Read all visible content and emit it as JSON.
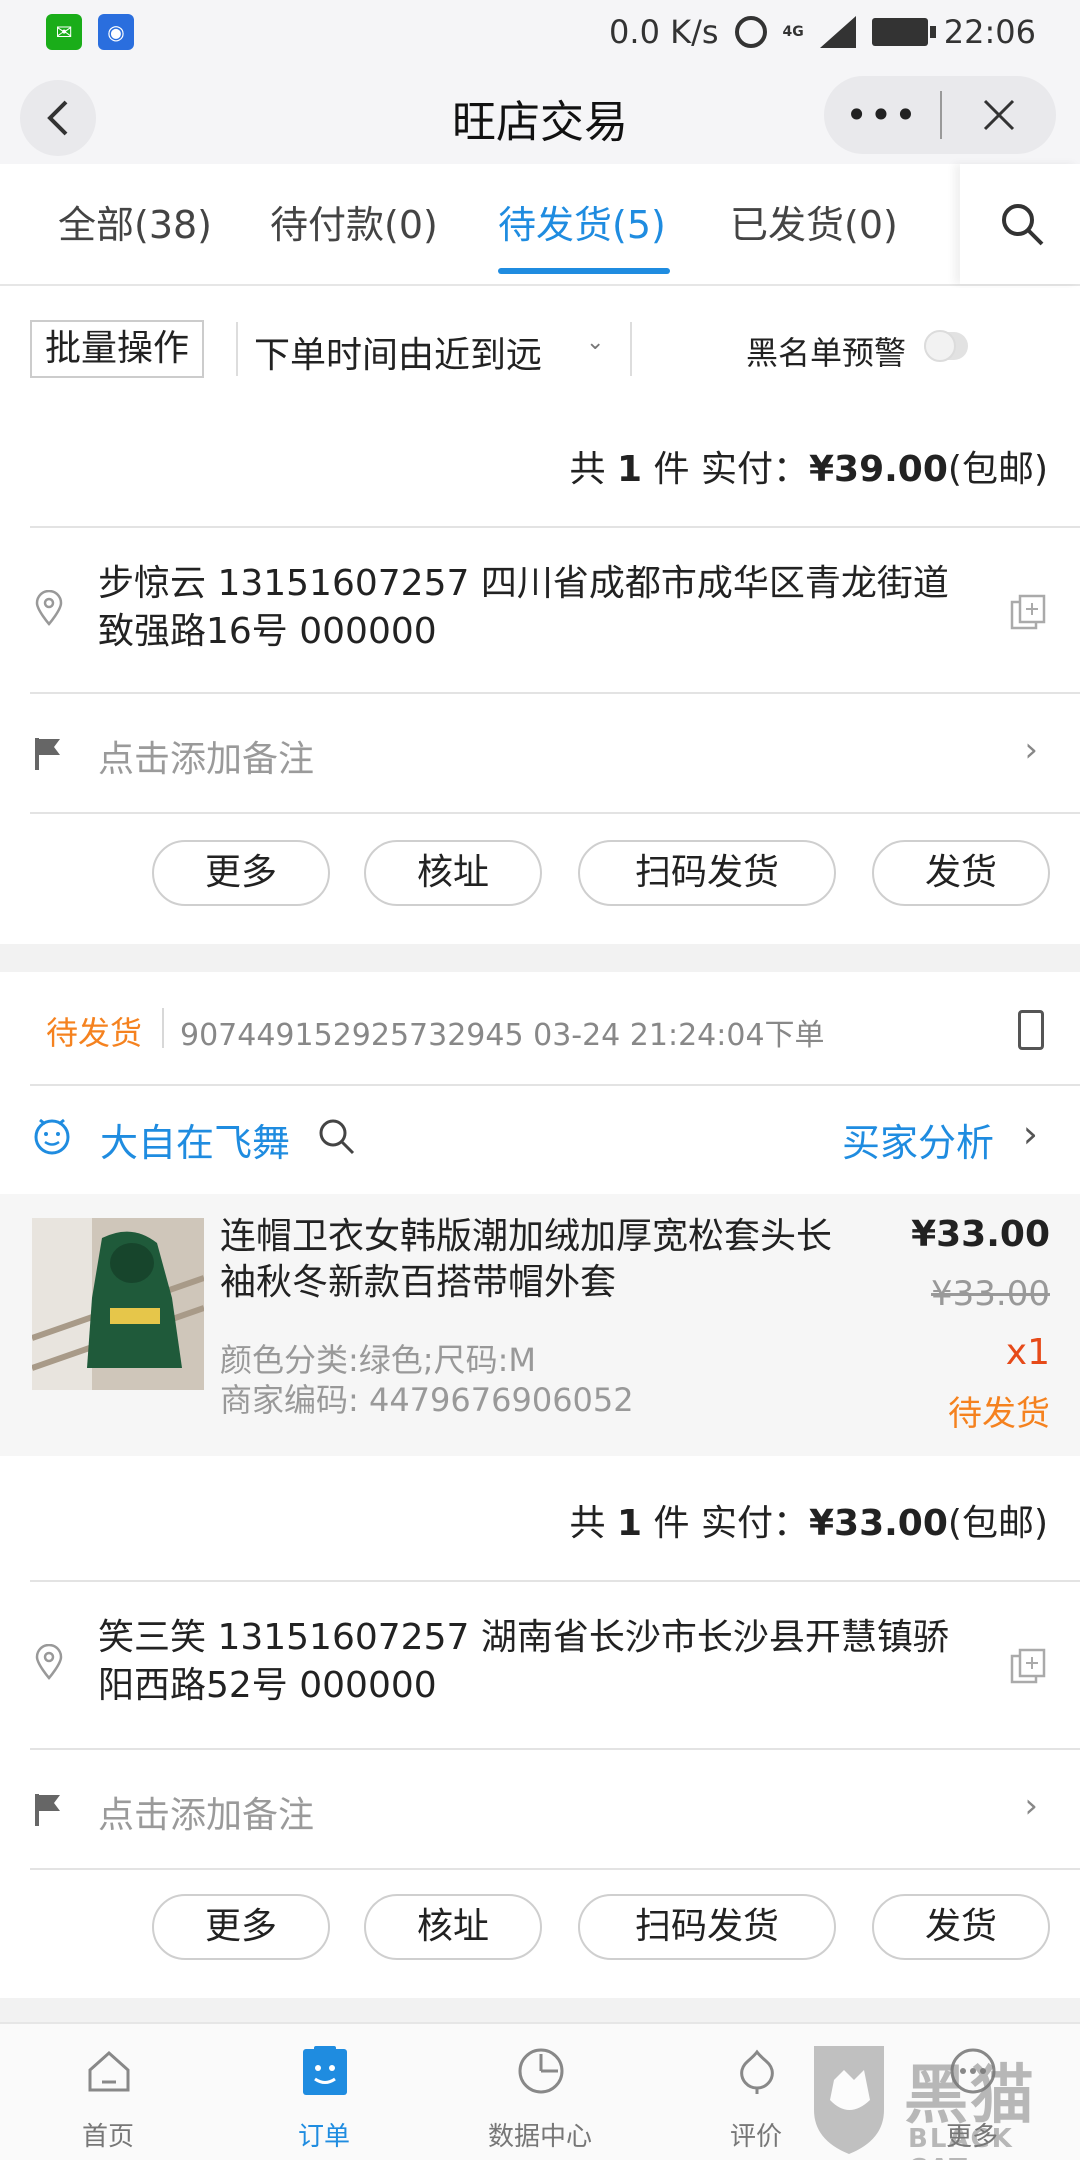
{
  "status_bar": {
    "net_speed": "0.0 K/s",
    "network": "4G",
    "time": "22:06"
  },
  "nav": {
    "title": "旺店交易",
    "more_label": "•••"
  },
  "tabs": [
    {
      "label": "全部(38)"
    },
    {
      "label": "待付款(0)"
    },
    {
      "label": "待发货(5)"
    },
    {
      "label": "已发货(0)"
    }
  ],
  "filter": {
    "batch_label": "批量操作",
    "sort_label": "下单时间由近到远",
    "blacklist_label": "黑名单预警",
    "blacklist_enabled": false
  },
  "order1": {
    "total_prefix": "共",
    "total_count": "1",
    "total_mid": "件 实付：",
    "total_amount": "¥39.00",
    "total_suffix": "(包邮)",
    "address": "步惊云 13151607257 四川省成都市成华区青龙街道致强路16号 000000",
    "note_placeholder": "点击添加备注",
    "actions": [
      "更多",
      "核址",
      "扫码发货",
      "发货"
    ]
  },
  "order2": {
    "status": "待发货",
    "order_meta": "907449152925732945  03-24 21:24:04下单",
    "shop_name": "大自在飞舞",
    "buyer_analysis": "买家分析",
    "item": {
      "title": "连帽卫衣女韩版潮加绒加厚宽松套头长袖秋冬新款百搭带帽外套",
      "sku": "颜色分类:绿色;尺码:M",
      "code": "商家编码: 4479676906052",
      "price": "¥33.00",
      "original_price": "¥33.00",
      "quantity": "x1",
      "status": "待发货"
    },
    "total_prefix": "共",
    "total_count": "1",
    "total_mid": "件 实付：",
    "total_amount": "¥33.00",
    "total_suffix": "(包邮)",
    "address": "笑三笑 13151607257 湖南省长沙市长沙县开慧镇骄阳西路52号 000000",
    "note_placeholder": "点击添加备注",
    "actions": [
      "更多",
      "核址",
      "扫码发货",
      "发货"
    ]
  },
  "bottom_tabs": [
    {
      "label": "首页",
      "icon": "home-icon"
    },
    {
      "label": "订单",
      "icon": "order-icon",
      "active": true
    },
    {
      "label": "数据中心",
      "icon": "data-center-icon"
    },
    {
      "label": "评价",
      "icon": "review-icon"
    },
    {
      "label": "更多",
      "icon": "more-icon"
    }
  ],
  "watermark": {
    "text": "黑猫",
    "sub": "BLACK CAT"
  },
  "colors": {
    "accent": "#1f8ce0",
    "pending": "#f5821f",
    "quantity": "#e64a19"
  }
}
